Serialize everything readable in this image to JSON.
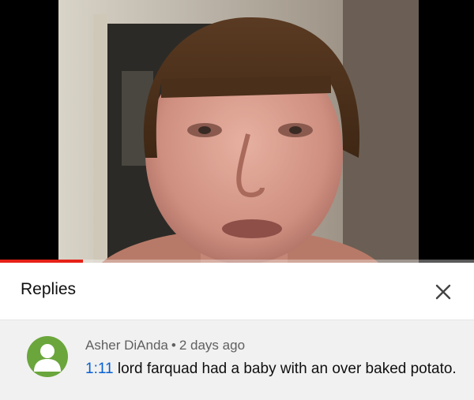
{
  "video": {
    "progress_fraction": 0.175,
    "progress_color": "#e62117"
  },
  "replies_panel": {
    "title": "Replies",
    "close_icon": "close-icon"
  },
  "comment": {
    "author": "Asher DiAnda",
    "separator": "•",
    "age": "2 days ago",
    "timestamp_link": "1:11",
    "text": " lord farquad had a baby with an over baked potato.",
    "avatar_color": "#6aa63c",
    "avatar_icon": "person-icon"
  }
}
